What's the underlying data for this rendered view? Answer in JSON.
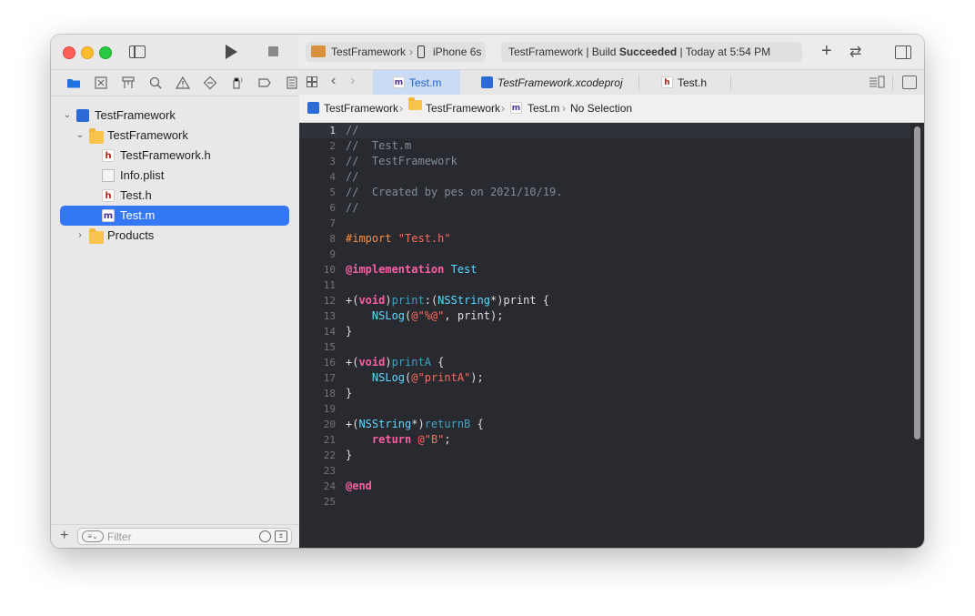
{
  "sidebar": {
    "navigator_icons": [
      "folder-icon",
      "x-square-icon",
      "hierarchy-icon",
      "search-icon",
      "warning-icon",
      "diamond-icon",
      "spray-icon",
      "tag-icon",
      "report-icon"
    ],
    "tree": [
      {
        "label": "TestFramework",
        "type": "project",
        "expanded": true
      },
      {
        "label": "TestFramework",
        "type": "folder",
        "expanded": true
      },
      {
        "label": "TestFramework.h",
        "type": "h"
      },
      {
        "label": "Info.plist",
        "type": "plist"
      },
      {
        "label": "Test.h",
        "type": "h"
      },
      {
        "label": "Test.m",
        "type": "m",
        "selected": true
      },
      {
        "label": "Products",
        "type": "folder",
        "expanded": false
      }
    ],
    "filter_placeholder": "Filter"
  },
  "toolbar": {
    "scheme": "TestFramework",
    "device": "iPhone 6s",
    "status_prefix": "TestFramework | Build ",
    "status_bold": "Succeeded",
    "status_suffix": " | Today at 5:54 PM"
  },
  "tabs": [
    {
      "label": "Test.m",
      "badge": "m",
      "active": true
    },
    {
      "label": "TestFramework.xcodeproj",
      "badge": "",
      "active": false
    },
    {
      "label": "Test.h",
      "badge": "h",
      "active": false
    }
  ],
  "jumpbar": {
    "items": [
      "TestFramework",
      "TestFramework",
      "Test.m",
      "No Selection"
    ]
  },
  "code": {
    "current_line": 1,
    "line_numbers": [
      "1",
      "2",
      "3",
      "4",
      "5",
      "6",
      "7",
      "8",
      "9",
      "10",
      "11",
      "12",
      "13",
      "14",
      "15",
      "16",
      "17",
      "18",
      "19",
      "20",
      "21",
      "22",
      "23",
      "24",
      "25"
    ],
    "lines": [
      [
        {
          "t": "//",
          "c": "cm"
        }
      ],
      [
        {
          "t": "//  Test.m",
          "c": "cm"
        }
      ],
      [
        {
          "t": "//  TestFramework",
          "c": "cm"
        }
      ],
      [
        {
          "t": "//",
          "c": "cm"
        }
      ],
      [
        {
          "t": "//  Created by pes on 2021/10/19.",
          "c": "cm"
        }
      ],
      [
        {
          "t": "//",
          "c": "cm"
        }
      ],
      [],
      [
        {
          "t": "#import ",
          "c": "pp"
        },
        {
          "t": "\"Test.h\"",
          "c": "str"
        }
      ],
      [],
      [
        {
          "t": "@implementation",
          "c": "kw"
        },
        {
          "t": " ",
          "c": "plain"
        },
        {
          "t": "Test",
          "c": "ty"
        }
      ],
      [],
      [
        {
          "t": "+(",
          "c": "plain"
        },
        {
          "t": "void",
          "c": "kw"
        },
        {
          "t": ")",
          "c": "plain"
        },
        {
          "t": "print",
          "c": "fn"
        },
        {
          "t": ":(",
          "c": "plain"
        },
        {
          "t": "NSString",
          "c": "ty"
        },
        {
          "t": "*)print {",
          "c": "plain"
        }
      ],
      [
        {
          "t": "    ",
          "c": "plain"
        },
        {
          "t": "NSLog",
          "c": "ty"
        },
        {
          "t": "(",
          "c": "plain"
        },
        {
          "t": "@\"%@\"",
          "c": "str"
        },
        {
          "t": ", print);",
          "c": "plain"
        }
      ],
      [
        {
          "t": "}",
          "c": "plain"
        }
      ],
      [],
      [
        {
          "t": "+(",
          "c": "plain"
        },
        {
          "t": "void",
          "c": "kw"
        },
        {
          "t": ")",
          "c": "plain"
        },
        {
          "t": "printA",
          "c": "fn"
        },
        {
          "t": " {",
          "c": "plain"
        }
      ],
      [
        {
          "t": "    ",
          "c": "plain"
        },
        {
          "t": "NSLog",
          "c": "ty"
        },
        {
          "t": "(",
          "c": "plain"
        },
        {
          "t": "@\"printA\"",
          "c": "str"
        },
        {
          "t": ");",
          "c": "plain"
        }
      ],
      [
        {
          "t": "}",
          "c": "plain"
        }
      ],
      [],
      [
        {
          "t": "+(",
          "c": "plain"
        },
        {
          "t": "NSString",
          "c": "ty"
        },
        {
          "t": "*)",
          "c": "plain"
        },
        {
          "t": "returnB",
          "c": "fn"
        },
        {
          "t": " {",
          "c": "plain"
        }
      ],
      [
        {
          "t": "    ",
          "c": "plain"
        },
        {
          "t": "return",
          "c": "kw"
        },
        {
          "t": " ",
          "c": "plain"
        },
        {
          "t": "@\"B\"",
          "c": "str"
        },
        {
          "t": ";",
          "c": "plain"
        }
      ],
      [
        {
          "t": "}",
          "c": "plain"
        }
      ],
      [],
      [
        {
          "t": "@end",
          "c": "kw"
        }
      ],
      []
    ]
  },
  "colors": {
    "editor_bg": "#292a30",
    "selection": "#3478f6",
    "comment": "#7f8c98",
    "keyword": "#fc5fa3",
    "type": "#5dd8ff",
    "string": "#fc6a5d",
    "preprocessor": "#fd8f3f"
  }
}
